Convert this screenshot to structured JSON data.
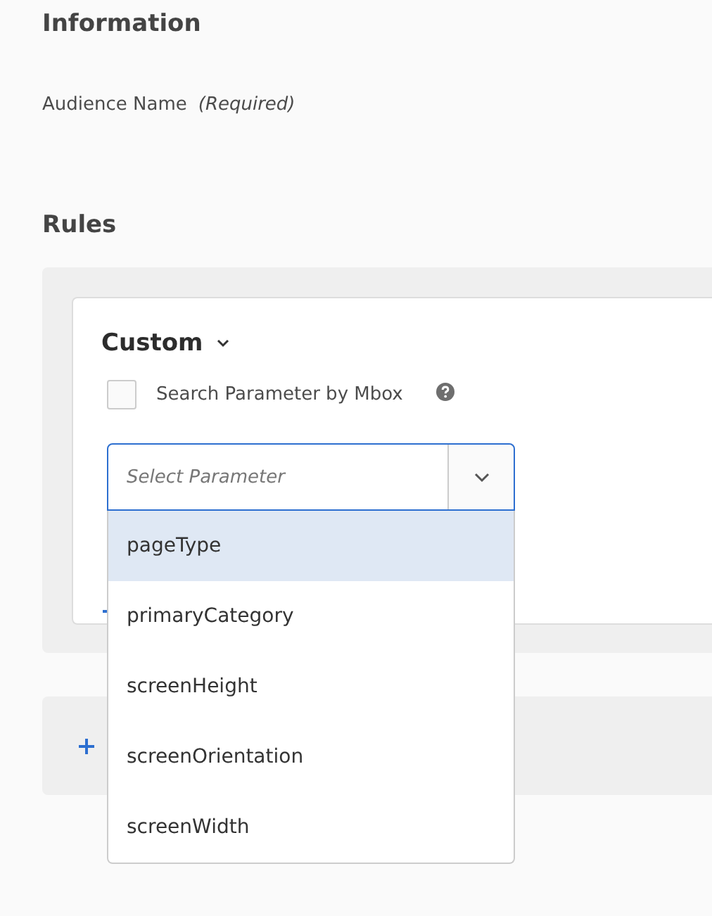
{
  "information": {
    "heading": "Information",
    "field_label": "Audience Name",
    "field_note": "(Required)"
  },
  "rules": {
    "heading": "Rules",
    "rule": {
      "type_label": "Custom",
      "checkbox": {
        "label": "Search Parameter by Mbox",
        "checked": false
      },
      "select": {
        "placeholder": "Select Parameter",
        "expanded": true,
        "options": [
          {
            "label": "pageType",
            "selected": true
          },
          {
            "label": "primaryCategory",
            "selected": false
          },
          {
            "label": "screenHeight",
            "selected": false
          },
          {
            "label": "screenOrientation",
            "selected": false
          },
          {
            "label": "screenWidth",
            "selected": false
          }
        ]
      }
    }
  }
}
